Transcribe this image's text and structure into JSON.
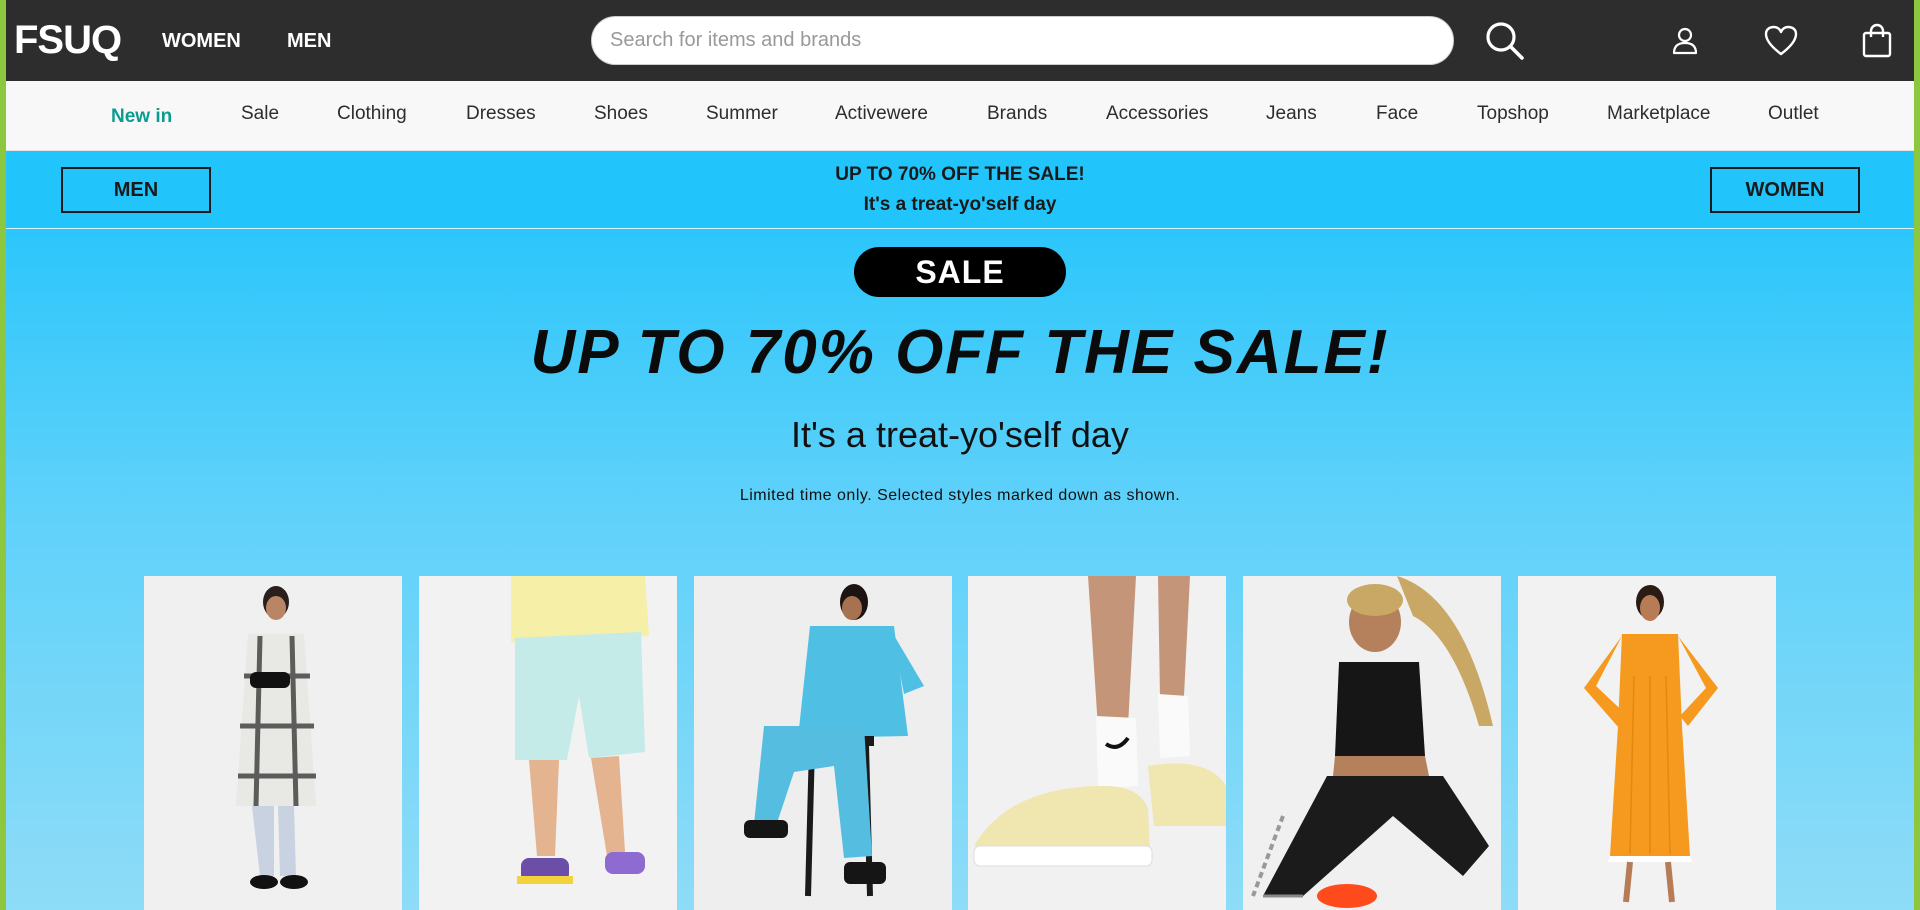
{
  "header": {
    "logo": "FSUQ",
    "nav_women": "WOMEN",
    "nav_men": "MEN",
    "search_placeholder": "Search for items and brands",
    "icons": [
      "search-icon",
      "account-icon",
      "heart-icon",
      "bag-icon"
    ]
  },
  "navbar": {
    "items": [
      "New in",
      "Sale",
      "Clothing",
      "Dresses",
      "Shoes",
      "Summer",
      "Activewere",
      "Brands",
      "Accessories",
      "Jeans",
      "Face",
      "Topshop",
      "Marketplace",
      "Outlet"
    ],
    "active_color": "#0b9c91"
  },
  "promo": {
    "men_button": "MEN",
    "women_button": "WOMEN",
    "line1": "UP TO 70% OFF THE SALE!",
    "line2": "It's a treat-yo'self day",
    "background": "#22c5fb"
  },
  "hero": {
    "badge": "SALE",
    "title": "UP TO 70% OFF THE SALE!",
    "subtitle": "It's a treat-yo'self day",
    "note": "Limited time only. Selected styles marked down as shown."
  },
  "products": [
    {
      "name": "plaid-coat-product-image",
      "accent": "#d8d8d8"
    },
    {
      "name": "mint-shorts-product-image",
      "accent": "#bfe7e4"
    },
    {
      "name": "denim-set-product-image",
      "accent": "#5cc4e6"
    },
    {
      "name": "sneakers-product-image",
      "accent": "#efe6b2"
    },
    {
      "name": "sports-bra-leggings-product-image",
      "accent": "#1c1c1c"
    },
    {
      "name": "orange-knit-dress-product-image",
      "accent": "#f59a1e"
    }
  ]
}
